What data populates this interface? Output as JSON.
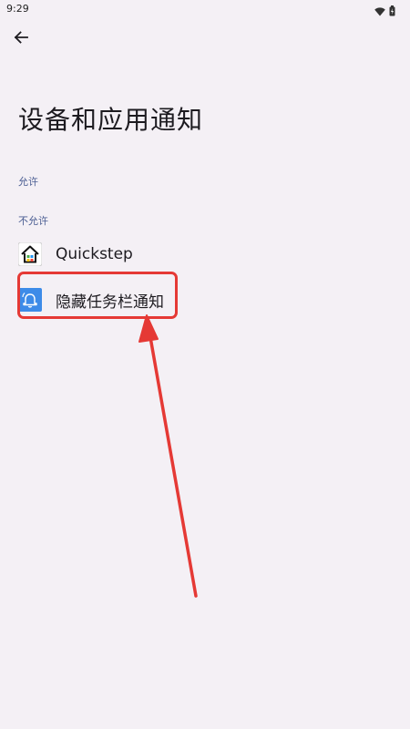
{
  "status_bar": {
    "time": "9:29",
    "icons": [
      "wifi-icon",
      "battery-icon"
    ]
  },
  "app_bar": {
    "back_icon": "arrow-left-icon"
  },
  "page": {
    "title": "设备和应用通知"
  },
  "sections": {
    "allowed_header": "允许",
    "not_allowed_header": "不允许"
  },
  "apps": [
    {
      "label": "Quickstep",
      "icon": "home-launcher-icon",
      "icon_color": "#ffffff"
    },
    {
      "label": "隐藏任务栏通知",
      "icon": "bell-notification-icon",
      "icon_color": "#3d8be8"
    }
  ],
  "annotation": {
    "color": "#e53935"
  }
}
